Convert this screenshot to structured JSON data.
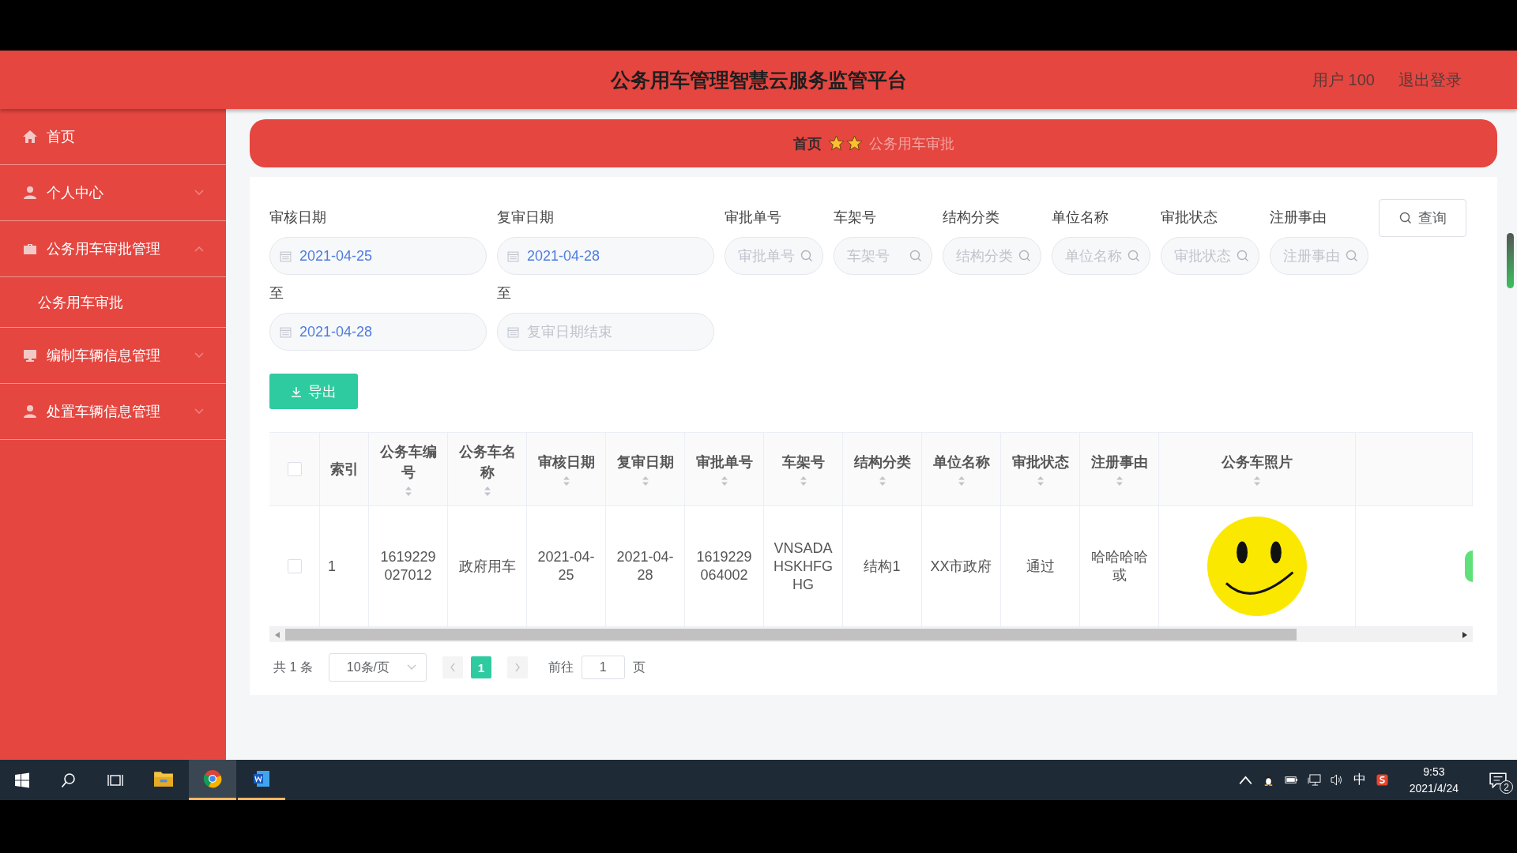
{
  "header": {
    "title": "公务用车管理智慧云服务监管平台",
    "user": "用户 100",
    "logout": "退出登录"
  },
  "sidebar": {
    "items": [
      {
        "label": "首页",
        "kind": "link"
      },
      {
        "label": "个人中心",
        "kind": "menu",
        "expanded": false
      },
      {
        "label": "公务用车审批管理",
        "kind": "menu",
        "expanded": true,
        "children": [
          {
            "label": "公务用车审批"
          }
        ]
      },
      {
        "label": "编制车辆信息管理",
        "kind": "menu",
        "expanded": false
      },
      {
        "label": "处置车辆信息管理",
        "kind": "menu",
        "expanded": false
      }
    ]
  },
  "breadcrumb": {
    "home": "首页",
    "current": "公务用车审批"
  },
  "filters": {
    "date_ranges": [
      {
        "label": "审核日期",
        "start": {
          "value": "2021-04-25"
        },
        "end_label": "至",
        "end": {
          "value": "2021-04-28"
        }
      },
      {
        "label": "复审日期",
        "start": {
          "value": "2021-04-28"
        },
        "end_label": "至",
        "end": {
          "placeholder": "复审日期结束"
        }
      }
    ],
    "text_filters": [
      {
        "label": "审批单号",
        "placeholder": "审批单号"
      },
      {
        "label": "车架号",
        "placeholder": "车架号"
      },
      {
        "label": "结构分类",
        "placeholder": "结构分类"
      },
      {
        "label": "单位名称",
        "placeholder": "单位名称"
      },
      {
        "label": "审批状态",
        "placeholder": "审批状态"
      },
      {
        "label": "注册事由",
        "placeholder": "注册事由"
      }
    ],
    "query_button": "查询",
    "export_button": "导出"
  },
  "table": {
    "select_all_checked": false,
    "columns": [
      {
        "label": "索引",
        "sortable": false
      },
      {
        "label": "公务车编号",
        "sortable": true
      },
      {
        "label": "公务车名称",
        "sortable": true
      },
      {
        "label": "审核日期",
        "sortable": true
      },
      {
        "label": "复审日期",
        "sortable": true
      },
      {
        "label": "审批单号",
        "sortable": true
      },
      {
        "label": "车架号",
        "sortable": true
      },
      {
        "label": "结构分类",
        "sortable": true
      },
      {
        "label": "单位名称",
        "sortable": true
      },
      {
        "label": "审批状态",
        "sortable": true
      },
      {
        "label": "注册事由",
        "sortable": true
      },
      {
        "label": "公务车照片",
        "sortable": true
      }
    ],
    "rows": [
      {
        "selected": false,
        "cells": [
          "1",
          "1619229027012",
          "政府用车",
          "2021-04-25",
          "2021-04-28",
          "1619229064002",
          "VNSADAHSKHFGHG",
          "结构1",
          "XX市政府",
          "通过",
          "哈哈哈哈或"
        ]
      }
    ]
  },
  "pagination": {
    "total": "共 1 条",
    "page_size": "10条/页",
    "pages": [
      {
        "label": "1",
        "selected": true
      }
    ],
    "goto_label": "前往",
    "goto_value": "1",
    "page_suffix": "页"
  },
  "taskbar": {
    "apps": [
      {
        "kind": "explorer",
        "running": false,
        "selected": false
      },
      {
        "kind": "chrome",
        "running": true,
        "selected": true
      },
      {
        "kind": "word",
        "running": true,
        "selected": false
      }
    ],
    "ime": "中",
    "time": "9:53",
    "date": "2021/4/24",
    "notifications": "2"
  }
}
